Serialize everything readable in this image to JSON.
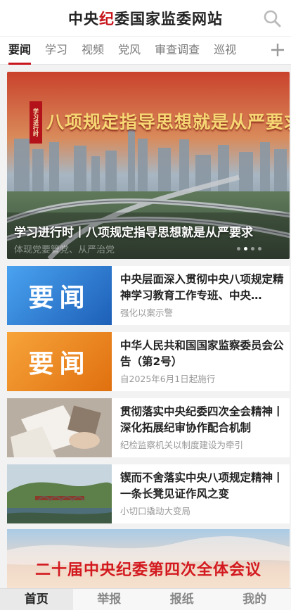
{
  "header": {
    "title_pre": "中央",
    "title_highlight": "纪",
    "title_post": "委国家监委网站"
  },
  "tabs": [
    {
      "label": "要闻",
      "active": true
    },
    {
      "label": "学习"
    },
    {
      "label": "视频"
    },
    {
      "label": "党风"
    },
    {
      "label": "审查调查"
    },
    {
      "label": "巡视"
    }
  ],
  "banner": {
    "tag": "学习进行时",
    "headline": "八项规定指导思想就是从严要求",
    "caption": "学习进行时丨八项规定指导思想就是从严要求",
    "sub": "体现党要管党、从严治党",
    "slide_index": 1,
    "slide_count": 4
  },
  "news": [
    {
      "title": "中央层面深入贯彻中央八项规定精神学习教育工作专班、中央…",
      "sub": "强化以案示警",
      "thumb_text": "要闻"
    },
    {
      "title": "中华人民共和国国家监察委员会公告（第2号）",
      "sub": "自2025年6月1日起施行",
      "thumb_text": "要闻"
    },
    {
      "title": "贯彻落实中央纪委四次全会精神丨深化拓展纪审协作配合机制",
      "sub": "纪检监察机关以制度建设为牵引"
    },
    {
      "title": "锲而不舍落实中央八项规定精神丨一条长凳见证作风之变",
      "sub": "小切口撬动大变局"
    }
  ],
  "meeting": {
    "title": "二十届中央纪委第四次全体会议"
  },
  "bottom_nav": [
    {
      "label": "首页",
      "active": true
    },
    {
      "label": "举报"
    },
    {
      "label": "报纸"
    },
    {
      "label": "我的"
    }
  ],
  "colors": {
    "brand_red": "#c8161d",
    "blue_thumb": "#2f7fd6",
    "orange_thumb": "#f08a1c"
  }
}
